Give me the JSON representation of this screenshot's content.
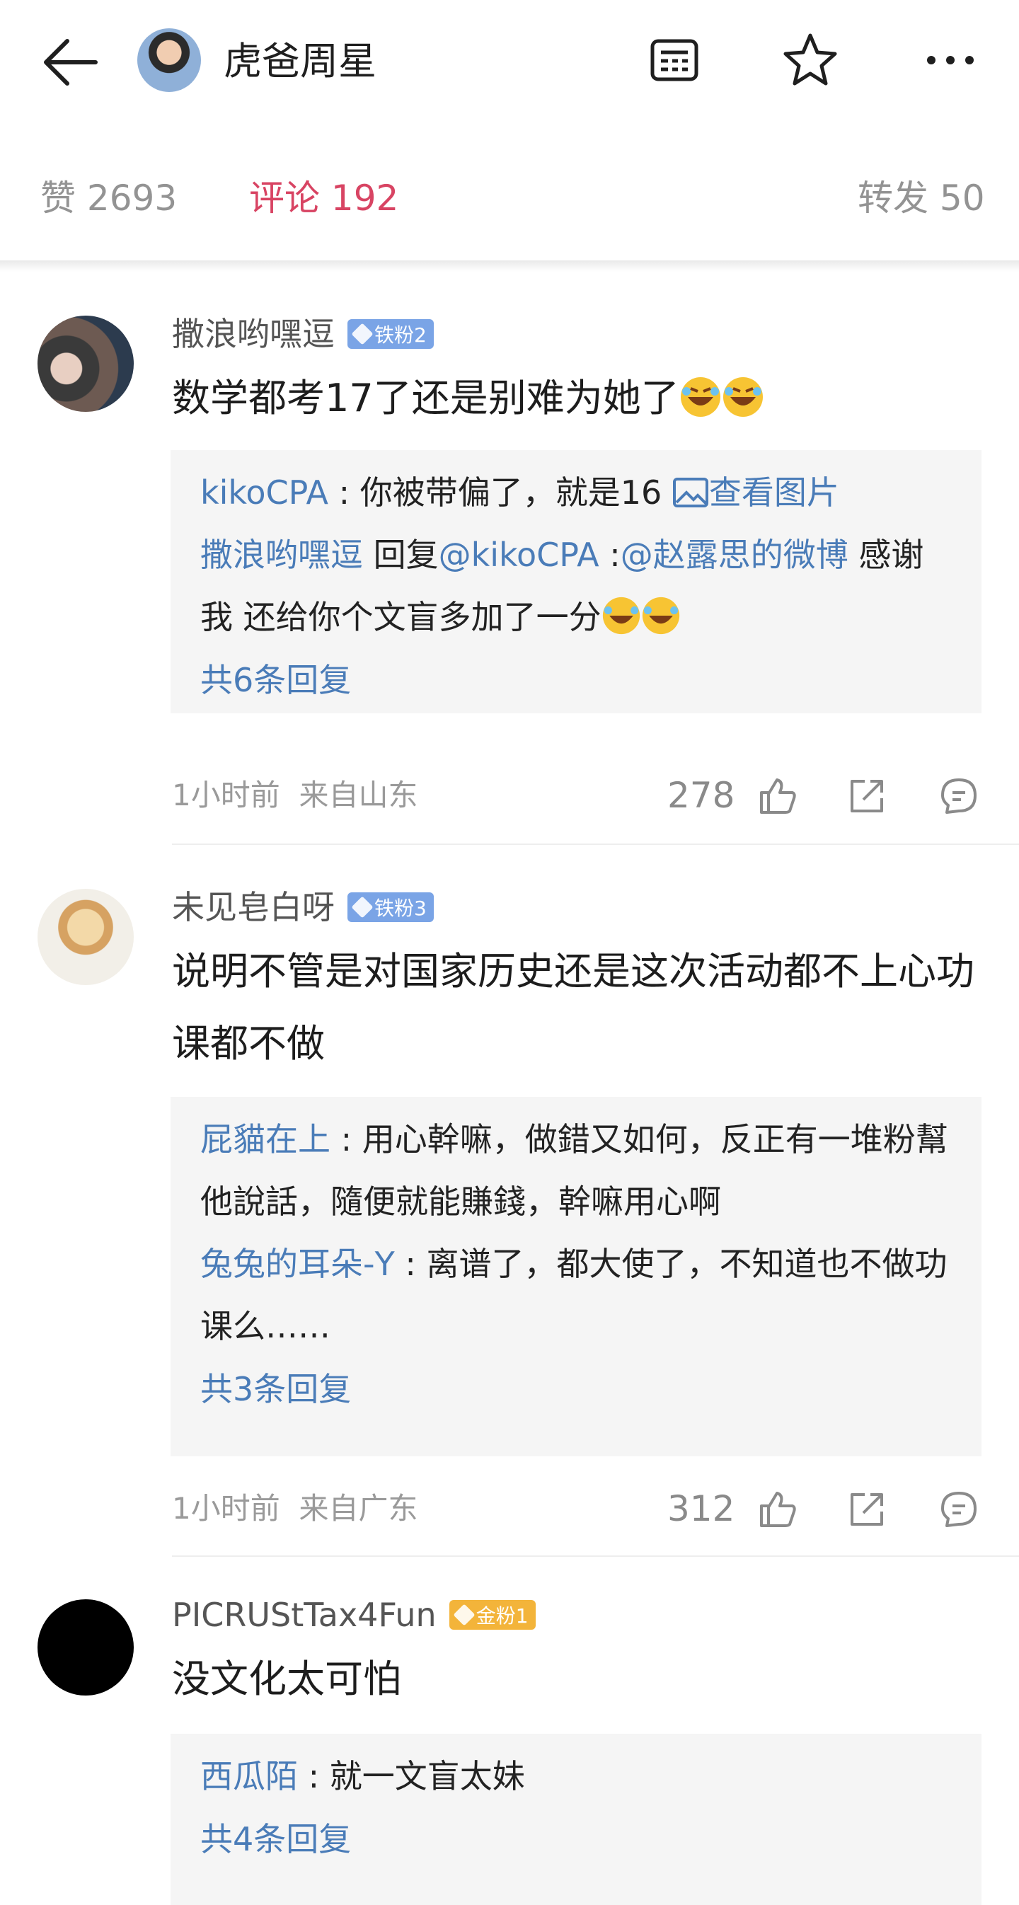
{
  "header": {
    "title": "虎爸周星",
    "icons": [
      "back-arrow-icon",
      "reader-icon",
      "star-icon",
      "more-icon"
    ]
  },
  "tabs": {
    "like_label": "赞 2693",
    "comment_label": "评论 192",
    "repost_label": "转发 50"
  },
  "comments": [
    {
      "name": "撒浪哟嘿逗",
      "badge": "铁粉2",
      "text": "数学都考17了还是别难为她了",
      "replies": [
        {
          "user": "kikoCPA",
          "sep": " : ",
          "text": "你被带偏了，就是16 ",
          "link": "查看图片"
        },
        {
          "user": "撒浪哟嘿逗",
          "sep": " 回复",
          "mention1": "@kikoCPA",
          "sep2": " :",
          "mention2": "@赵露思的微博",
          "text": " 感谢我 还给你个文盲多加了一分"
        }
      ],
      "more": "共6条回复",
      "time": "1小时前",
      "location": "来自山东",
      "likes": "278"
    },
    {
      "name": "未见皂白呀",
      "badge": "铁粉3",
      "text": "说明不管是对国家历史还是这次活动都不上心功课都不做",
      "replies": [
        {
          "user": "屁貓在上",
          "sep": " : ",
          "text": "用心幹嘛，做錯又如何，反正有一堆粉幫他說話，隨便就能賺錢，幹嘛用心啊"
        },
        {
          "user": "兔兔的耳朵-Y",
          "sep": " : ",
          "text": "离谱了，都大使了，不知道也不做功课么……"
        }
      ],
      "more": "共3条回复",
      "time": "1小时前",
      "location": "来自广东",
      "likes": "312"
    },
    {
      "name": "PICRUStTax4Fun",
      "badge": "金粉1",
      "text": "没文化太可怕",
      "replies": [
        {
          "user": "西瓜陌",
          "sep": " : ",
          "text": "就一文盲太妹"
        }
      ],
      "more": "共4条回复"
    }
  ],
  "colors": {
    "accent": "#d84463",
    "link": "#4a7cb8",
    "muted": "#939393",
    "iron_badge": "#7aa4e6",
    "gold_badge": "#f3b43a"
  }
}
